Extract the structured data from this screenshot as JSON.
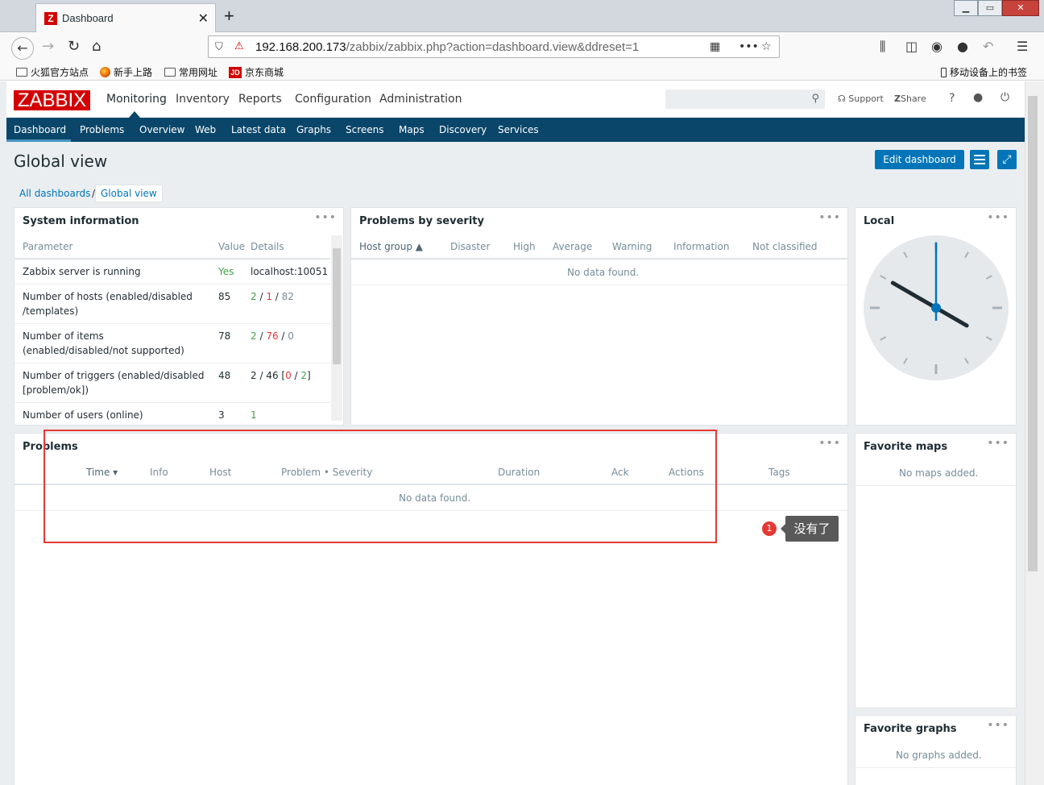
{
  "browser": {
    "tab_title": "Dashboard",
    "tab_favicon_letter": "Z",
    "url_host": "192.168.200.173",
    "url_path": "/zabbix/zabbix.php?action=dashboard.view&ddreset=1",
    "bookmarks": [
      "火狐官方站点",
      "新手上路",
      "常用网址",
      "京东商城"
    ],
    "mobile_bookmarks": "移动设备上的书签"
  },
  "zabbix": {
    "logo": "ZABBIX",
    "top_menu": [
      "Monitoring",
      "Inventory",
      "Reports",
      "Configuration",
      "Administration"
    ],
    "search_placeholder": "",
    "support": "Support",
    "share": "Share",
    "help": "?",
    "sub_menu": [
      "Dashboard",
      "Problems",
      "Overview",
      "Web",
      "Latest data",
      "Graphs",
      "Screens",
      "Maps",
      "Discovery",
      "Services"
    ],
    "page_title": "Global view",
    "edit_dashboard": "Edit dashboard",
    "breadcrumbs": [
      "All dashboards",
      "Global view"
    ]
  },
  "system_info": {
    "title": "System information",
    "headers": [
      "Parameter",
      "Value",
      "Details"
    ],
    "rows": [
      {
        "param": "Zabbix server is running",
        "value": "Yes",
        "details": "localhost:10051"
      },
      {
        "param": "Number of hosts (enabled/disabled /templates)",
        "value": "85",
        "d1": "2",
        "d2": "1",
        "d3": "82"
      },
      {
        "param": "Number of items (enabled/disabled/not supported)",
        "value": "78",
        "d1": "2",
        "d2": "76",
        "d3": "0"
      },
      {
        "param": "Number of triggers (enabled/disabled [problem/ok])",
        "value": "48",
        "d0": "2 / 46 [",
        "d1": "0",
        "d2": "2",
        "d3": "]"
      },
      {
        "param": "Number of users (online)",
        "value": "3",
        "details": "1"
      }
    ]
  },
  "problems_by_severity": {
    "title": "Problems by severity",
    "headers": [
      "Host group ▲",
      "Disaster",
      "High",
      "Average",
      "Warning",
      "Information",
      "Not classified"
    ],
    "empty": "No data found."
  },
  "local_clock": {
    "title": "Local",
    "hour": 4,
    "minute": 0
  },
  "problems": {
    "title": "Problems",
    "headers": [
      "Time ▾",
      "Info",
      "Host",
      "Problem • Severity",
      "Duration",
      "Ack",
      "Actions",
      "Tags"
    ],
    "empty": "No data found."
  },
  "favorite_maps": {
    "title": "Favorite maps",
    "empty": "No maps added."
  },
  "favorite_graphs": {
    "title": "Favorite graphs",
    "empty": "No graphs added."
  },
  "annotation": {
    "badge": "1",
    "text": "没有了"
  },
  "colors": {
    "accent": "#0275b8",
    "submenu_bg": "#0a466a",
    "logo_red": "#d40000",
    "ok_green": "#429e47",
    "problem_red": "#e33734"
  }
}
